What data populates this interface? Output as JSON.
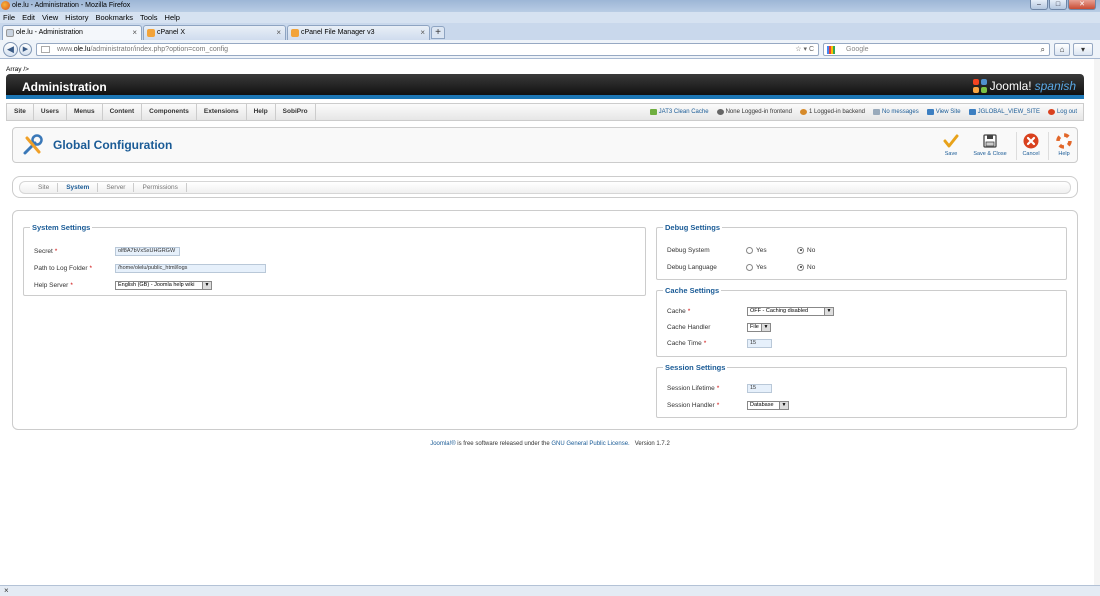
{
  "browser": {
    "window_title": "ole.lu - Administration - Mozilla Firefox",
    "menu": [
      "File",
      "Edit",
      "View",
      "History",
      "Bookmarks",
      "Tools",
      "Help"
    ],
    "tabs": [
      {
        "label": "ole.lu - Administration"
      },
      {
        "label": "cPanel X"
      },
      {
        "label": "cPanel File Manager v3"
      }
    ],
    "new_tab": "+",
    "url_prefix": "www.",
    "url_domain": "ole.lu",
    "url_rest": "/administrator/index.php?option=com_config",
    "search_placeholder": "Google",
    "status_close": "×"
  },
  "page": {
    "array_text": "Array />",
    "admin_title": "Administration",
    "logo_text": "Joomla!",
    "logo_lang": "spanish",
    "main_menu": [
      "Site",
      "Users",
      "Menus",
      "Content",
      "Components",
      "Extensions",
      "Help",
      "SobiPro"
    ],
    "status": {
      "jat3": "JAT3 Clean Cache",
      "frontend": "None Logged-in frontend",
      "backend": "1 Logged-in backend",
      "messages": "No messages",
      "view_site": "View Site",
      "jglobal": "JGLOBAL_VIEW_SITE",
      "logout": "Log out"
    },
    "toolbar": {
      "title": "Global Configuration",
      "save": "Save",
      "save_close": "Save & Close",
      "cancel": "Cancel",
      "help": "Help"
    },
    "subtabs": [
      "Site",
      "System",
      "Server",
      "Permissions"
    ],
    "system_settings": {
      "legend": "System Settings",
      "secret_label": "Secret",
      "secret_value": "olf8A7bVxSxUHGRGW",
      "log_label": "Path to Log Folder",
      "log_value": "/home/olelu/public_html/logs",
      "help_label": "Help Server",
      "help_value": "English (GB) - Joomla help wiki"
    },
    "debug_settings": {
      "legend": "Debug Settings",
      "system_label": "Debug System",
      "language_label": "Debug Language",
      "yes": "Yes",
      "no": "No"
    },
    "cache_settings": {
      "legend": "Cache Settings",
      "cache_label": "Cache",
      "cache_value": "OFF - Caching disabled",
      "handler_label": "Cache Handler",
      "handler_value": "File",
      "time_label": "Cache Time",
      "time_value": "15"
    },
    "session_settings": {
      "legend": "Session Settings",
      "lifetime_label": "Session Lifetime",
      "lifetime_value": "15",
      "handler_label": "Session Handler",
      "handler_value": "Database"
    },
    "footer": {
      "joomla": "Joomla!®",
      "text1": " is free software released under the ",
      "license": "GNU General Public License.",
      "version": "Version 1.7.2"
    }
  },
  "colors": {
    "accent": "#1a5b96",
    "admin_bar": "#111111",
    "admin_bar_line": "#1d77b5",
    "save_icon": "#e8a21a",
    "cancel_icon": "#d9411e",
    "help_icon": "#e2672a"
  }
}
